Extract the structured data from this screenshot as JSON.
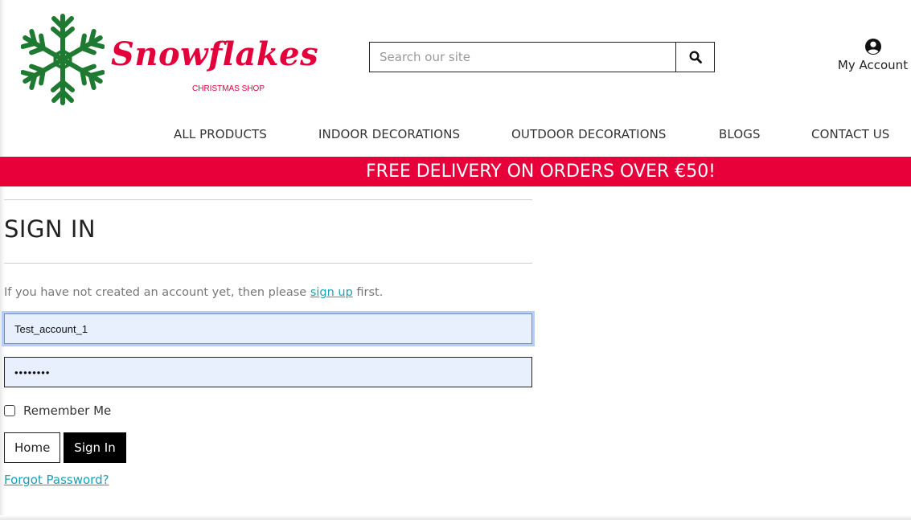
{
  "brand": {
    "name": "Snowflakes",
    "tagline": "CHRISTMAS SHOP",
    "accent_color": "#e4003b",
    "logo_green": "#1e7a31"
  },
  "header": {
    "search_placeholder": "Search our site",
    "search_icon": "magnifier-icon",
    "account_icon": "user-circle-icon",
    "account_label": "My Account"
  },
  "nav": {
    "items": [
      "ALL PRODUCTS",
      "INDOOR DECORATIONS",
      "OUTDOOR DECORATIONS",
      "BLOGS",
      "CONTACT US"
    ]
  },
  "banner": {
    "text": "FREE DELIVERY ON ORDERS OVER €50!",
    "color": "#e8003a"
  },
  "signin": {
    "title": "SIGN IN",
    "intro_before": "If you have not created an account yet, then please ",
    "intro_link": "sign up",
    "intro_after": " first.",
    "username_value": "Test_account_1",
    "password_value": "••••••••",
    "remember_label": "Remember Me",
    "home_button": "Home",
    "signin_button": "Sign In",
    "forgot_link": "Forgot Password?",
    "link_color": "#17a2b8"
  }
}
